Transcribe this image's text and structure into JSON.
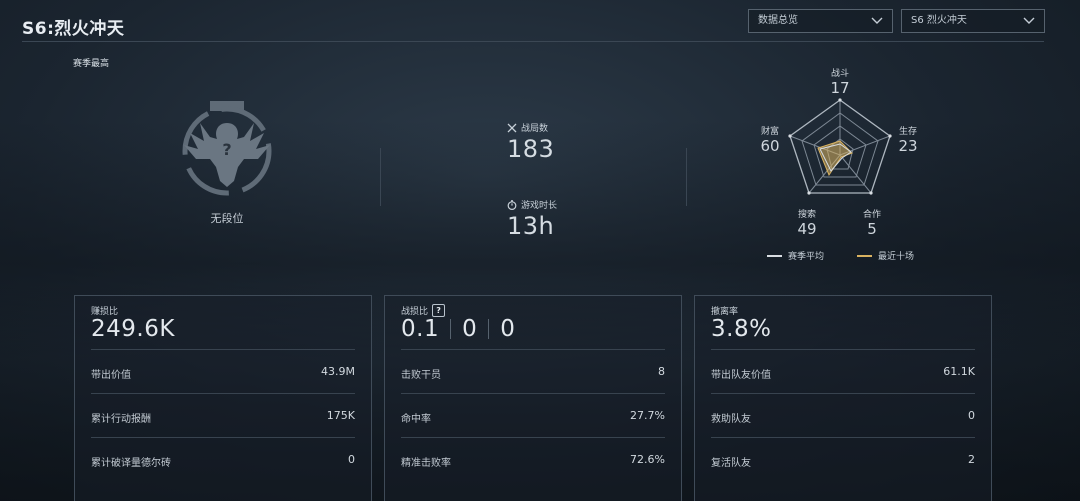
{
  "header": {
    "title": "S6:烈火冲天",
    "dropdown_view": "数据总览",
    "dropdown_season": "S6 烈火冲天"
  },
  "rank": {
    "section_label": "赛季最高",
    "name": "无段位"
  },
  "stats": {
    "matches_label": "战局数",
    "matches_value": "183",
    "playtime_label": "游戏时长",
    "playtime_value": "13h"
  },
  "radar": {
    "axes": [
      {
        "label": "战斗",
        "value": "17"
      },
      {
        "label": "生存",
        "value": "23"
      },
      {
        "label": "合作",
        "value": "5"
      },
      {
        "label": "搜索",
        "value": "49"
      },
      {
        "label": "财富",
        "value": "60"
      }
    ],
    "legend_season_avg": "赛季平均",
    "legend_recent": "最近十场",
    "color_season_avg": "#d8dde2",
    "color_recent": "#d9b260"
  },
  "cards": {
    "profit": {
      "label": "赚损比",
      "value": "249.6K",
      "rows": [
        {
          "key": "带出价值",
          "val": "43.9M"
        },
        {
          "key": "累计行动报酬",
          "val": "175K"
        },
        {
          "key": "累计破译量德尔砖",
          "val": "0"
        }
      ]
    },
    "combat": {
      "label": "战损比",
      "help_badge": "?",
      "values": [
        "0.1",
        "0",
        "0"
      ],
      "rows": [
        {
          "key": "击败干员",
          "val": "8"
        },
        {
          "key": "命中率",
          "val": "27.7%"
        },
        {
          "key": "精准击败率",
          "val": "72.6%"
        }
      ]
    },
    "extract": {
      "label": "撤离率",
      "value": "3.8%",
      "rows": [
        {
          "key": "带出队友价值",
          "val": "61.1K"
        },
        {
          "key": "救助队友",
          "val": "0"
        },
        {
          "key": "复活队友",
          "val": "2"
        }
      ]
    }
  }
}
